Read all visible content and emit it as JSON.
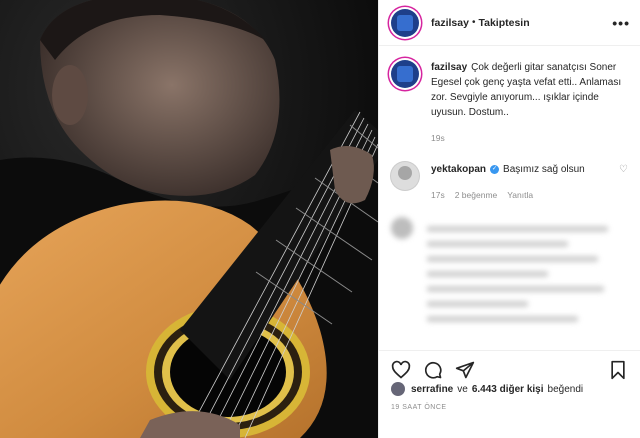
{
  "post": {
    "username": "fazilsay",
    "separator": "•",
    "follow_status": "Takiptesin",
    "more_label": "•••"
  },
  "caption": {
    "username": "fazilsay",
    "text": "Çok değerli gitar sanatçısı Soner Egesel çok genç yaşta vefat etti.. Anlaması zor. Sevgiyle anıyorum... ışıklar içinde uyusun. Dostum..",
    "time": "19s"
  },
  "comments": [
    {
      "username": "yektakopan",
      "verified": true,
      "text": "Başımız sağ olsun",
      "time": "17s",
      "likes": "2 beğenme",
      "reply_label": "Yanıtla"
    }
  ],
  "likes": {
    "user": "serrafine",
    "connector": "ve",
    "others": "6.443 diğer kişi",
    "suffix": "beğendi"
  },
  "timestamp": "19 SAAT ÖNCE",
  "icons": [
    "heart-icon",
    "comment-icon",
    "share-icon",
    "bookmark-icon",
    "verified-icon",
    "more-icon"
  ]
}
